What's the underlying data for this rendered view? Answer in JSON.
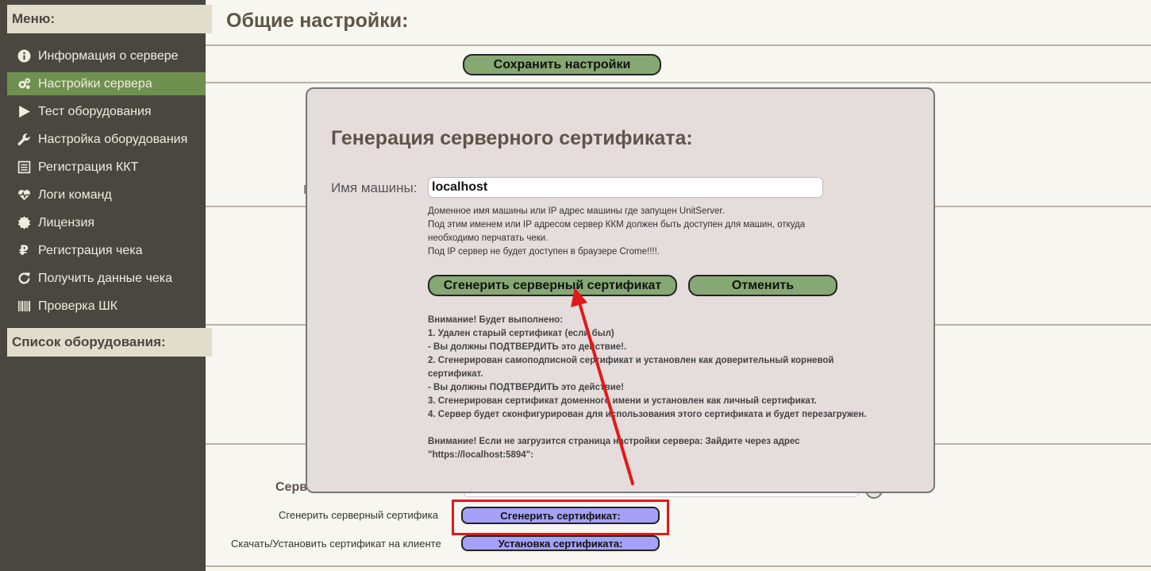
{
  "sidebar": {
    "menu_title": "Меню:",
    "items": [
      {
        "label": "Информация о сервере",
        "icon": "info-icon"
      },
      {
        "label": "Настройки сервера",
        "icon": "gears-icon",
        "active": true
      },
      {
        "label": "Тест оборудования",
        "icon": "play-icon"
      },
      {
        "label": "Настройка оборудования",
        "icon": "wrench-icon"
      },
      {
        "label": "Регистрация ККТ",
        "icon": "register-icon"
      },
      {
        "label": "Логи команд",
        "icon": "heartbeat-icon"
      },
      {
        "label": "Лицензия",
        "icon": "seal-icon"
      },
      {
        "label": "Регистрация чека",
        "icon": "ruble-icon"
      },
      {
        "label": "Получить данные чека",
        "icon": "refresh-icon"
      },
      {
        "label": "Проверка ШК",
        "icon": "barcode-icon"
      }
    ],
    "equipment_title": "Список оборудования:"
  },
  "main": {
    "title": "Общие настройки:",
    "save_button": "Сохранить настройки",
    "server_label_partial": "Серв",
    "generate_label": "Сгенерить серверный сертифика",
    "generate_button": "Сгенерить сертификат:",
    "download_label": "Скачать/Установить сертификат на клиенте",
    "install_button": "Установка сертификата:"
  },
  "modal": {
    "title": "Генерация серверного сертификата:",
    "host_label": "Имя машины:",
    "host_value": "localhost",
    "hint_lines": [
      "Доменное имя машины или IP адрес машины где запущен UnitServer.",
      "Под этим именем или IP адресом сервер ККМ должен быть доступен для машин, откуда",
      "необходимо перчатать чеки.",
      "Под IP сервер не будет доступен в браузере Crome!!!!."
    ],
    "generate_button": "Сгенерить серверный сертификат",
    "cancel_button": "Отменить",
    "warning_lines": [
      "Внимание! Будет выполнено:",
      "1. Удален старый сертификат (если был)",
      "- Вы должны ПОДТВЕРДИТЬ это действие!.",
      "2. Сгенерирован самоподписной сертификат и установлен как доверительный корневой",
      "сертификат.",
      "- Вы должны ПОДТВЕРДИТЬ это действие!",
      "3. Сгенерирован сертификат доменного имени и установлен как личный сертификат.",
      "4. Сервер будет сконфигурирован для использования этого сертификата и будет перезагружен.",
      "",
      "Внимание! Если не загрузится страница настройки сервера: Зайдите через адрес",
      "\"https://localhost:5894\":"
    ]
  },
  "colors": {
    "sidebar_bg": "#4a4740",
    "sidebar_active": "#6f9150",
    "button_green": "#86a873",
    "button_blue": "#a5a0f8",
    "annotation_red": "#e31919"
  }
}
